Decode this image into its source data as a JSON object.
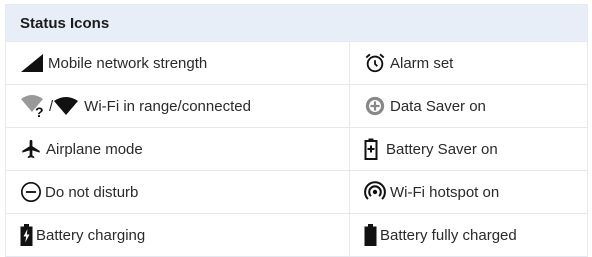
{
  "table": {
    "title": "Status Icons",
    "rows": [
      {
        "left": {
          "icon": "signal-strength-icon",
          "label": "Mobile network strength"
        },
        "right": {
          "icon": "alarm-clock-icon",
          "label": "Alarm set"
        }
      },
      {
        "left": {
          "icon": "wifi-icon",
          "separator": "/",
          "label": "Wi-Fi in range/connected"
        },
        "right": {
          "icon": "data-saver-icon",
          "label": "Data Saver on"
        }
      },
      {
        "left": {
          "icon": "airplane-icon",
          "label": "Airplane mode"
        },
        "right": {
          "icon": "battery-saver-icon",
          "label": "Battery Saver on"
        }
      },
      {
        "left": {
          "icon": "do-not-disturb-icon",
          "label": "Do not disturb"
        },
        "right": {
          "icon": "wifi-hotspot-icon",
          "label": "Wi-Fi hotspot on"
        }
      },
      {
        "left": {
          "icon": "battery-charging-icon",
          "label": "Battery charging"
        },
        "right": {
          "icon": "battery-full-icon",
          "label": "Battery fully charged"
        }
      }
    ]
  }
}
